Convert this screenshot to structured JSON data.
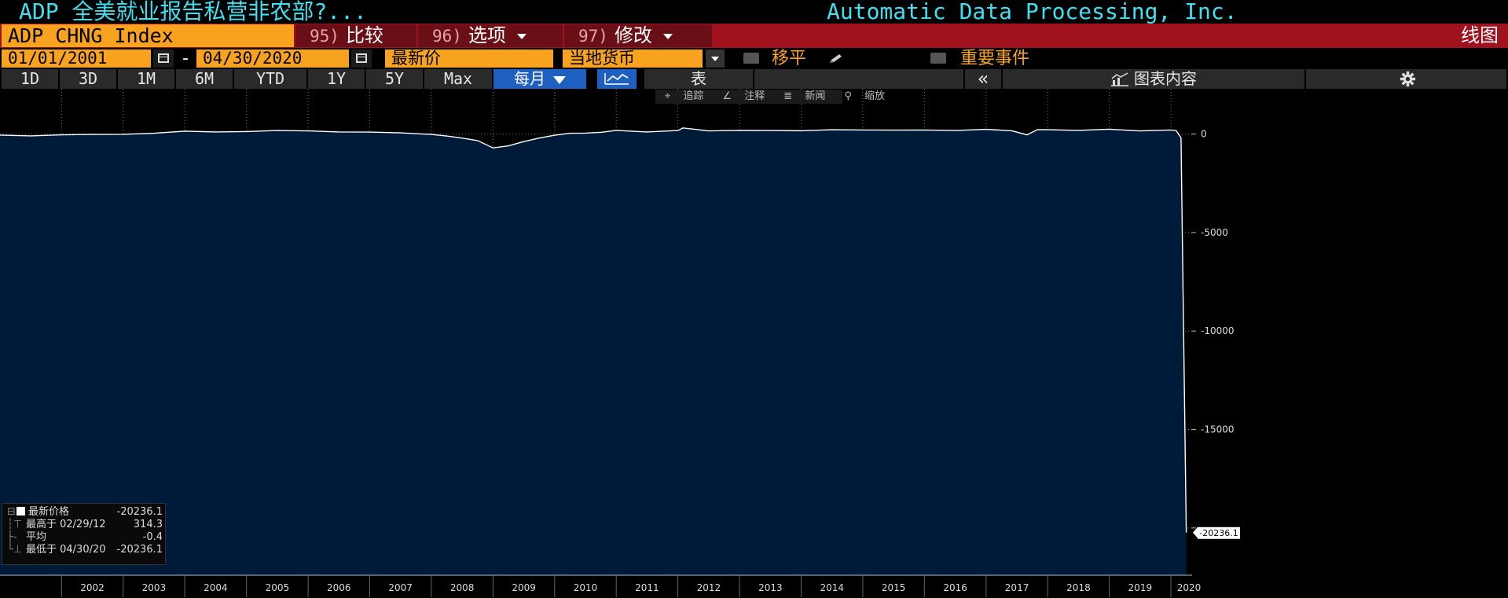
{
  "header": {
    "title_left": "ADP 全美就业报告私营非农部?...",
    "title_right": "Automatic Data Processing, Inc."
  },
  "menu": {
    "ticker": "ADP CHNG Index",
    "compare": {
      "num": "95)",
      "label": "比较"
    },
    "options": {
      "num": "96)",
      "label": "选项"
    },
    "edit": {
      "num": "97)",
      "label": "修改"
    },
    "view_label": "线图"
  },
  "range": {
    "start": "01/01/2001",
    "dash": "-",
    "end": "04/30/2020",
    "field": "最新价",
    "currency": "当地货币",
    "smooth": "移平",
    "events": "重要事件"
  },
  "periods": {
    "buttons": [
      "1D",
      "3D",
      "1M",
      "6M",
      "YTD",
      "1Y",
      "5Y",
      "Max"
    ],
    "frequency": "每月",
    "table": "表",
    "collapse": "«",
    "chart_content": "图表内容"
  },
  "chart_tools": {
    "track": "追踪",
    "annotate": "注释",
    "news": "新闻",
    "zoom": "缩放"
  },
  "legend": {
    "last_label": "最新价格",
    "last_value": "-20236.1",
    "high_label": "最高于 02/29/12",
    "high_value": "314.3",
    "avg_label": "平均",
    "avg_value": "-0.4",
    "low_label": "最低于 04/30/20",
    "low_value": "-20236.1"
  },
  "colors": {
    "fill": "#001a3a",
    "line": "#ffffff",
    "grid": "#7a7a7a",
    "accent_orange": "#f7a31f",
    "menu_red": "#a0121e",
    "title_cyan": "#3fe0f0"
  },
  "chart_data": {
    "type": "area",
    "title": "",
    "xlabel": "",
    "ylabel": "",
    "ylim": [
      -22400,
      2300
    ],
    "yticks": [
      0,
      -5000,
      -10000,
      -15000,
      -20000
    ],
    "ytick_labels": [
      "0",
      "-5000",
      "-10000",
      "-15000",
      ""
    ],
    "xtick_labels": [
      "2002",
      "2003",
      "2004",
      "2005",
      "2006",
      "2007",
      "2008",
      "2009",
      "2010",
      "2011",
      "2012",
      "2013",
      "2014",
      "2015",
      "2016",
      "2017",
      "2018",
      "2019",
      "2020"
    ],
    "last_value_label": "-20236.1",
    "grid": true,
    "series": [
      {
        "points": [
          [
            "2001-01",
            -50
          ],
          [
            "2001-07",
            -90
          ],
          [
            "2002-01",
            -40
          ],
          [
            "2002-07",
            -20
          ],
          [
            "2003-01",
            -10
          ],
          [
            "2003-07",
            40
          ],
          [
            "2004-01",
            150
          ],
          [
            "2004-07",
            110
          ],
          [
            "2005-01",
            130
          ],
          [
            "2005-07",
            180
          ],
          [
            "2006-01",
            160
          ],
          [
            "2006-07",
            110
          ],
          [
            "2007-01",
            100
          ],
          [
            "2007-07",
            60
          ],
          [
            "2008-01",
            -20
          ],
          [
            "2008-04",
            -100
          ],
          [
            "2008-07",
            -200
          ],
          [
            "2008-10",
            -330
          ],
          [
            "2009-01",
            -700
          ],
          [
            "2009-04",
            -600
          ],
          [
            "2009-07",
            -380
          ],
          [
            "2009-10",
            -200
          ],
          [
            "2010-01",
            -60
          ],
          [
            "2010-04",
            40
          ],
          [
            "2010-07",
            50
          ],
          [
            "2010-10",
            90
          ],
          [
            "2011-01",
            190
          ],
          [
            "2011-07",
            110
          ],
          [
            "2012-01",
            180
          ],
          [
            "2012-02",
            314.3
          ],
          [
            "2012-07",
            160
          ],
          [
            "2013-01",
            190
          ],
          [
            "2013-07",
            180
          ],
          [
            "2014-01",
            170
          ],
          [
            "2014-07",
            220
          ],
          [
            "2015-01",
            210
          ],
          [
            "2015-07",
            200
          ],
          [
            "2016-01",
            210
          ],
          [
            "2016-07",
            180
          ],
          [
            "2017-01",
            240
          ],
          [
            "2017-06",
            170
          ],
          [
            "2017-09",
            -40
          ],
          [
            "2017-11",
            230
          ],
          [
            "2018-01",
            220
          ],
          [
            "2018-07",
            190
          ],
          [
            "2019-01",
            250
          ],
          [
            "2019-07",
            160
          ],
          [
            "2020-01",
            210
          ],
          [
            "2020-02",
            180
          ],
          [
            "2020-03",
            -190
          ],
          [
            "2020-04",
            -20236.1
          ]
        ]
      }
    ]
  }
}
